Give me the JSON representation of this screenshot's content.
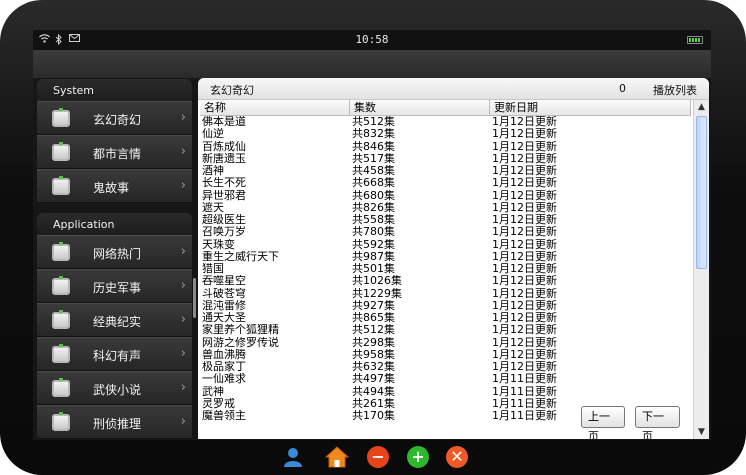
{
  "statusbar": {
    "time": "10:58",
    "icons": [
      "wifi-icon",
      "bluetooth-icon",
      "mail-icon",
      "battery-icon"
    ]
  },
  "sidebar": {
    "system_header": "System",
    "system_items": [
      {
        "label": "玄幻奇幻"
      },
      {
        "label": "都市言情"
      },
      {
        "label": "鬼故事"
      }
    ],
    "application_header": "Application",
    "application_items": [
      {
        "label": "网络热门"
      },
      {
        "label": "历史军事"
      },
      {
        "label": "经典纪实"
      },
      {
        "label": "科幻有声"
      },
      {
        "label": "武侠小说"
      },
      {
        "label": "刑侦推理"
      }
    ]
  },
  "panel": {
    "title": "玄幻奇幻",
    "count": "0",
    "playlist_label": "播放列表",
    "columns": [
      "名称",
      "集数",
      "更新日期"
    ],
    "rows": [
      [
        "佛本是道",
        "共512集",
        "1月12日更新"
      ],
      [
        "仙逆",
        "共832集",
        "1月12日更新"
      ],
      [
        "百炼成仙",
        "共846集",
        "1月12日更新"
      ],
      [
        "新唐遗玉",
        "共517集",
        "1月12日更新"
      ],
      [
        "酒神",
        "共458集",
        "1月12日更新"
      ],
      [
        "长生不死",
        "共668集",
        "1月12日更新"
      ],
      [
        "异世邪君",
        "共680集",
        "1月12日更新"
      ],
      [
        "遮天",
        "共826集",
        "1月12日更新"
      ],
      [
        "超级医生",
        "共558集",
        "1月12日更新"
      ],
      [
        "召唤万岁",
        "共780集",
        "1月12日更新"
      ],
      [
        "天珠变",
        "共592集",
        "1月12日更新"
      ],
      [
        "重生之威行天下",
        "共987集",
        "1月12日更新"
      ],
      [
        "猎国",
        "共501集",
        "1月12日更新"
      ],
      [
        "吞噬星空",
        "共1026集",
        "1月12日更新"
      ],
      [
        "斗破苍穹",
        "共1229集",
        "1月12日更新"
      ],
      [
        "混沌雷修",
        "共927集",
        "1月12日更新"
      ],
      [
        "通天大圣",
        "共865集",
        "1月12日更新"
      ],
      [
        "家里养个狐狸精",
        "共512集",
        "1月12日更新"
      ],
      [
        "网游之修罗传说",
        "共298集",
        "1月12日更新"
      ],
      [
        "兽血沸腾",
        "共958集",
        "1月12日更新"
      ],
      [
        "极品家丁",
        "共632集",
        "1月12日更新"
      ],
      [
        "一仙难求",
        "共497集",
        "1月11日更新"
      ],
      [
        "武神",
        "共494集",
        "1月11日更新"
      ],
      [
        "灵罗戒",
        "共261集",
        "1月11日更新"
      ],
      [
        "魔兽领主",
        "共170集",
        "1月11日更新"
      ]
    ],
    "prev_label": "上一页",
    "next_label": "下一页"
  },
  "dock": {
    "icons": [
      "user-icon",
      "home-icon",
      "minus-icon",
      "add-icon",
      "close-icon"
    ]
  },
  "colors": {
    "accent_green": "#2db82d",
    "home_orange": "#f08a1c",
    "minus_red": "#e8441c",
    "close_red": "#f05a28",
    "user_blue": "#3b8ad8"
  }
}
